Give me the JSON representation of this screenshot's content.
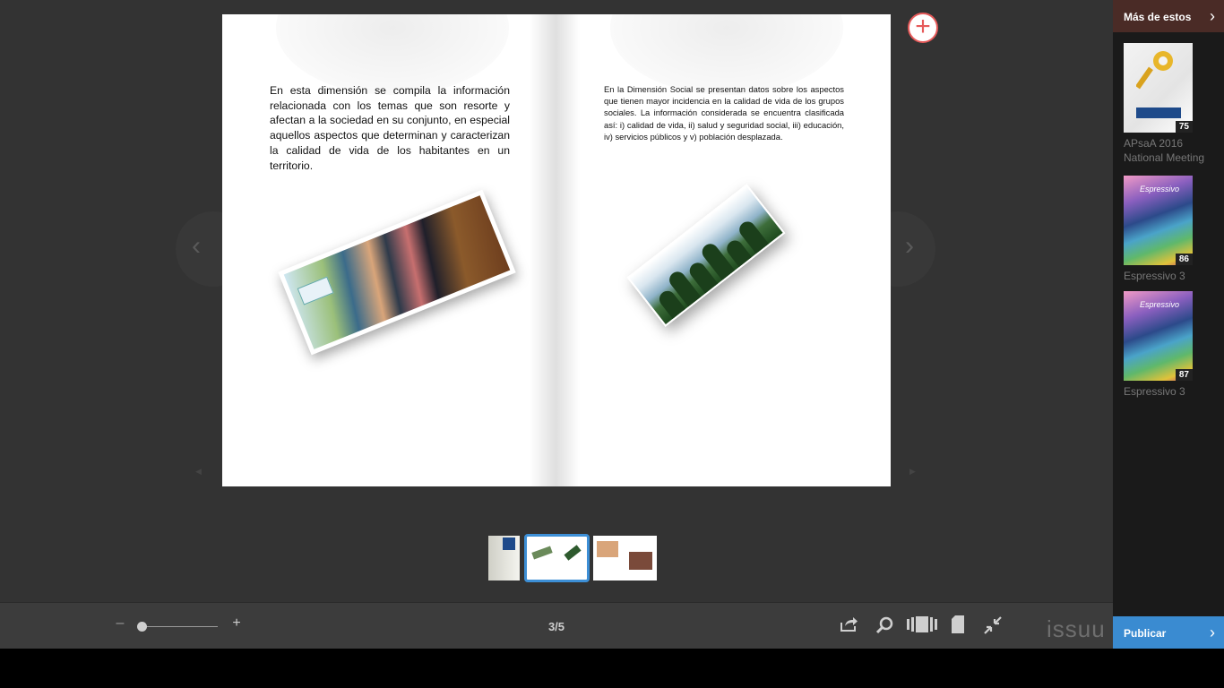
{
  "reader": {
    "left_page_text": "En esta dimensión se compila la información relacionada con los temas que son resorte y afectan a la sociedad en su conjunto, en especial aquellos aspectos que determinan y caracterizan la calidad de vida de los habitantes en un territorio.",
    "right_page_text": "En la Dimensión Social se presentan datos sobre los aspectos que tienen mayor incidencia en la calidad de vida de los grupos sociales. La información considerada se encuentra clasificada así: i) calidad de vida, ii) salud y seguridad social, iii) educación, iv) servicios públicos y v) población desplazada.",
    "add_button_glyph": "+",
    "prev_glyph": "‹",
    "next_glyph": "›"
  },
  "toolbar": {
    "zoom_out_glyph": "–",
    "zoom_in_glyph": "+",
    "page_indicator": "3/5",
    "brand": "issuu",
    "zoom_level": 0
  },
  "sidebar": {
    "header": "Más de estos",
    "items": [
      {
        "title": "APsaA 2016 National Meeting",
        "count": "75"
      },
      {
        "title": "Espressivo 3",
        "count": "86"
      },
      {
        "title": "Espressivo 3",
        "count": "87"
      }
    ],
    "publish_label": "Publicar"
  },
  "colors": {
    "background": "#333333",
    "sidebar_header": "#4a2b26",
    "publish": "#3a8bd1",
    "active_thumb_border": "#3d8fd6",
    "add_button": "#e65a5a"
  }
}
